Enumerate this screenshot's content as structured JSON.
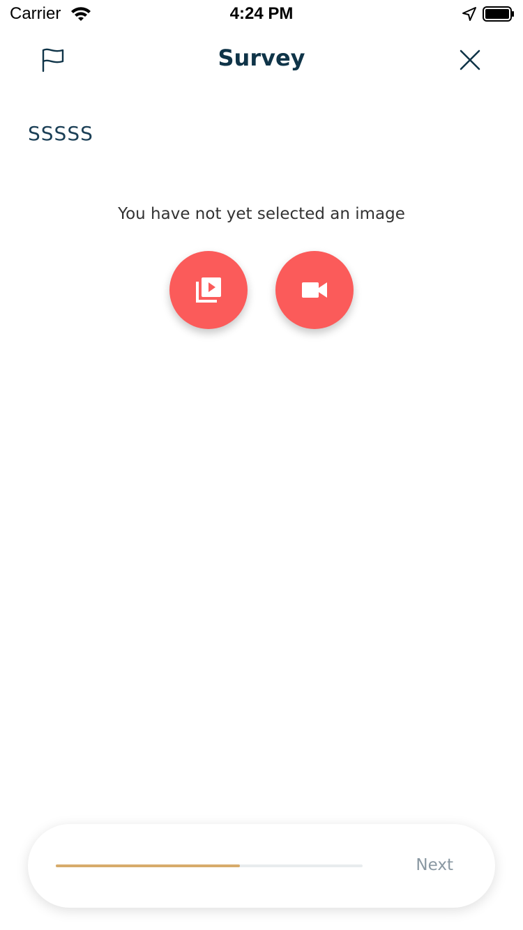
{
  "status_bar": {
    "carrier": "Carrier",
    "time": "4:24 PM",
    "icons": [
      "wifi-icon",
      "location-arrow-icon",
      "battery-icon"
    ]
  },
  "nav": {
    "title": "Survey",
    "left_icon": "flag-icon",
    "right_icon": "close-icon"
  },
  "question": {
    "text": "SSSSS"
  },
  "media": {
    "empty_message": "You have not yet selected an image",
    "library_icon": "video-library-icon",
    "camera_icon": "video-camera-icon"
  },
  "footer": {
    "next_label": "Next",
    "progress": 0.6
  },
  "colors": {
    "accent": "#fb5b5a",
    "title": "#0f3448",
    "progress": "#d7ab6b",
    "next_text": "#8a98a2"
  }
}
